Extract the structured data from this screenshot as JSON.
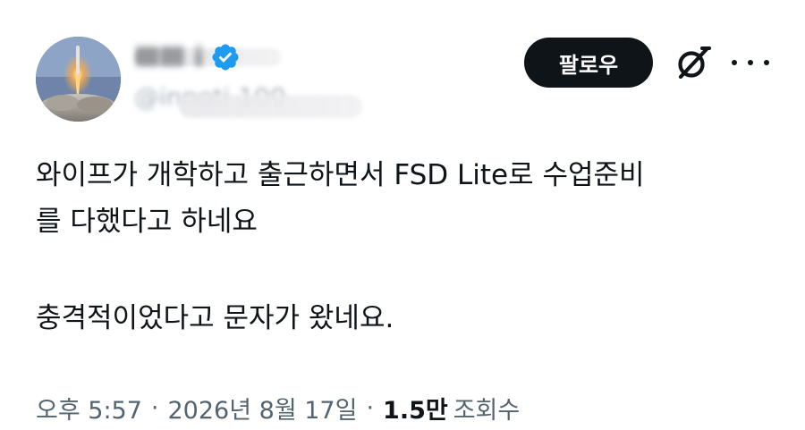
{
  "author": {
    "display_name": "ⅢⅢ i",
    "handle": "@innoti 100",
    "verified": true,
    "avatar_icon": "rocket-launch-icon"
  },
  "actions": {
    "follow_label": "팔로우",
    "grok_icon": "grok-icon",
    "more_icon": "more-options-icon"
  },
  "tweet": {
    "lines": [
      "와이프가 개학하고 출근하면서 FSD Lite로 수업준비",
      "를 다했다고 하네요",
      "",
      "충격적이었다고 문자가 왔네요."
    ]
  },
  "meta": {
    "time": "오후 5:57",
    "separator": "·",
    "date": "2026년 8월 17일",
    "views_count": "1.5만",
    "views_label": "조회수"
  },
  "colors": {
    "text": "#0f1419",
    "secondary": "#536471",
    "verified": "#1d9bf0",
    "follow_bg": "#0f1419"
  }
}
